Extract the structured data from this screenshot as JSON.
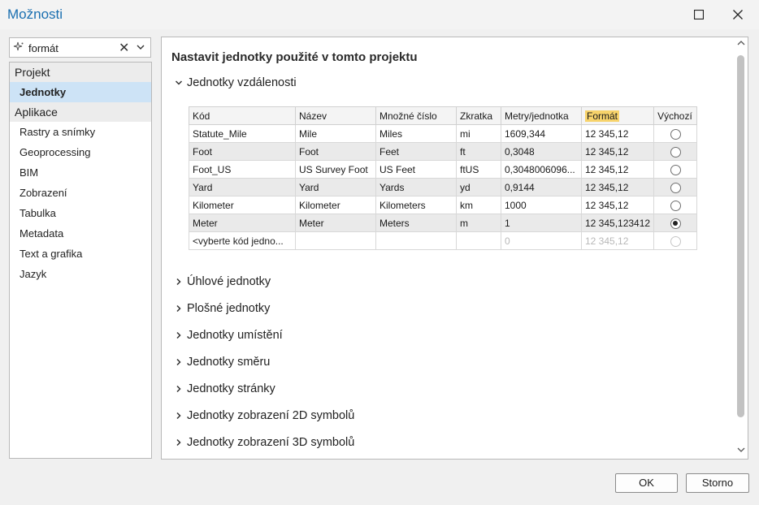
{
  "window": {
    "title": "Možnosti"
  },
  "search": {
    "value": "formát"
  },
  "sidebar": {
    "groups": [
      {
        "label": "Projekt",
        "items": [
          {
            "label": "Jednotky",
            "selected": true
          }
        ]
      },
      {
        "label": "Aplikace",
        "items": [
          {
            "label": "Rastry a snímky"
          },
          {
            "label": "Geoprocessing"
          },
          {
            "label": "BIM"
          },
          {
            "label": "Zobrazení"
          },
          {
            "label": "Tabulka"
          },
          {
            "label": "Metadata"
          },
          {
            "label": "Text a grafika"
          },
          {
            "label": "Jazyk"
          }
        ]
      }
    ]
  },
  "main": {
    "heading": "Nastavit jednotky použité v tomto projektu",
    "expanded_section": "Jednotky vzdálenosti",
    "table": {
      "columns": [
        "Kód",
        "Název",
        "Množné číslo",
        "Zkratka",
        "Metry/jednotka",
        "Formát",
        "Výchozí"
      ],
      "highlighted_column": "Formát",
      "rows": [
        {
          "code": "Statute_Mile",
          "name": "Mile",
          "plural": "Miles",
          "abbr": "mi",
          "meters": "1609,344",
          "format": "12 345,12",
          "default": false
        },
        {
          "code": "Foot",
          "name": "Foot",
          "plural": "Feet",
          "abbr": "ft",
          "meters": "0,3048",
          "format": "12 345,12",
          "default": false
        },
        {
          "code": "Foot_US",
          "name": "US Survey Foot",
          "plural": "US Feet",
          "abbr": "ftUS",
          "meters": "0,3048006096...",
          "format": "12 345,12",
          "default": false
        },
        {
          "code": "Yard",
          "name": "Yard",
          "plural": "Yards",
          "abbr": "yd",
          "meters": "0,9144",
          "format": "12 345,12",
          "default": false
        },
        {
          "code": "Kilometer",
          "name": "Kilometer",
          "plural": "Kilometers",
          "abbr": "km",
          "meters": "1000",
          "format": "12 345,12",
          "default": false
        },
        {
          "code": "Meter",
          "name": "Meter",
          "plural": "Meters",
          "abbr": "m",
          "meters": "1",
          "format": "12 345,123412",
          "default": true
        }
      ],
      "placeholder_row": {
        "code": "<vyberte kód jedno...",
        "meters": "0",
        "format": "12 345,12"
      }
    },
    "collapsed_sections": [
      "Úhlové jednotky",
      "Plošné jednotky",
      "Jednotky umístění",
      "Jednotky směru",
      "Jednotky stránky",
      "Jednotky zobrazení 2D symbolů",
      "Jednotky zobrazení 3D symbolů"
    ]
  },
  "buttons": {
    "ok": "OK",
    "cancel": "Storno"
  },
  "colors": {
    "accent": "#1a6fb0",
    "selection": "#cde3f6",
    "highlight": "#f7d36b"
  }
}
